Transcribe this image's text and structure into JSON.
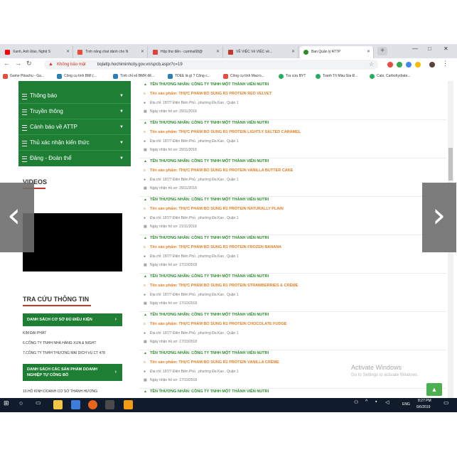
{
  "browser": {
    "tabs": [
      {
        "title": "Xanh, Anh Đào, Nghệ S",
        "color": "#ff0000"
      },
      {
        "title": "Tính năng chat dành cho N",
        "color": "#e74c3c"
      },
      {
        "title": "Hộp thư đến - cumhui68@",
        "color": "#db4437"
      },
      {
        "title": "VỀ VIỆC Về VIỆC về...",
        "color": "#c0392b"
      },
      {
        "title": "Ban Quản lý ATTP",
        "color": "#2e8b2e"
      }
    ],
    "new_tab": "+",
    "security_label": "Không bảo mật",
    "url": "bqlattp.hochiminhcity.gov.vn/spcb.aspx?c=19",
    "bookmarks": [
      {
        "label": "Game Pikachu - Ga...",
        "color": "#e74c3c"
      },
      {
        "label": "Công cụ tính BMI (...",
        "color": "#2980b9"
      },
      {
        "label": "Tính chỉ số BMR để...",
        "color": "#2980b9"
      },
      {
        "label": "TDEE là gì ? Công c...",
        "color": "#2980b9"
      },
      {
        "label": "Công cụ tính Macro...",
        "color": "#e74c3c"
      },
      {
        "label": "Tra cứu BYT",
        "color": "#27ae60"
      },
      {
        "label": "Tranh Tô Màu Gia Đ...",
        "color": "#27ae60"
      },
      {
        "label": "Calo, Carbohydrate...",
        "color": "#27ae60"
      }
    ]
  },
  "sidebar": {
    "menu": [
      {
        "label": "Thông báo"
      },
      {
        "label": "Truyền thông"
      },
      {
        "label": "Cảnh báo về ATTP"
      },
      {
        "label": "Thủ xác nhận kiến thức"
      },
      {
        "label": "Đảng - Đoàn thể"
      }
    ],
    "videos_heading": "VIDEOS",
    "lookup_heading": "TRA CỨU THÔNG TIN",
    "btn1": "DANH SÁCH CƠ SỞ ĐỦ ĐIỀU KIỆN",
    "list1": [
      "KIM ĐẠI PHÁT",
      "6.CÔNG TY TNHH NHÀ HÀNG XƯA & NIGHT",
      "7.CÔNG TY TNHH THƯƠNG MẠI DỊCH VỤ CT 478"
    ],
    "btn2_line1": "DANH SÁCH CÁC SẢN PHẨM DOANH",
    "btn2_line2": "NGHIỆP TỰ CÔNG BỐ",
    "list2": [
      "10.HỘ KINH DOANH CƠ SỞ THANH HƯƠNG"
    ]
  },
  "entries": [
    {
      "company": "TÊN THƯƠNG NHÂN: CÔNG TY TNHH MỘT THÀNH VIÊN NUTRI",
      "product": "Tên sản phẩm: THỰC PHẨM BỔ SUNG R1 PROTEIN RED VELVET",
      "address": "Địa chỉ: 187/7 Điện Biên Phủ , phường Đa Kao , Quận 1",
      "date": "Ngày nhận hồ sơ: 29/11/2018"
    },
    {
      "company": "TÊN THƯƠNG NHÂN: CÔNG TY TNHH MỘT THÀNH VIÊN NUTRI",
      "product": "Tên sản phẩm: THỰC PHẨM BỔ SUNG R1 PROTEIN LIGHTLY SALTED CARAMEL",
      "address": "Địa chỉ: 187/7 Điện Biên Phủ , phường Đa Kao , Quận 1",
      "date": "Ngày nhận hồ sơ: 29/11/2018"
    },
    {
      "company": "TÊN THƯƠNG NHÂN: CÔNG TY TNHH MỘT THÀNH VIÊN NUTRI",
      "product": "Tên sản phẩm: THỰC PHẨM BỔ SUNG R1 PROTEIN VANILLA BUTTER CAKE",
      "address": "Địa chỉ: 187/7 Điện Biên Phủ , phường Đa Kao , Quận 1",
      "date": "Ngày nhận hồ sơ: 29/11/2018"
    },
    {
      "company": "TÊN THƯƠNG NHÂN: CÔNG TY TNHH MỘT THÀNH VIÊN NUTRI",
      "product": "Tên sản phẩm: THỰC PHẨM BỔ SUNG R1 PROTEIN NATURALLY PLAIN",
      "address": "Địa chỉ: 187/7 Điện Biên Phủ , phường Đa Kao , Quận 1",
      "date": "Ngày nhận hồ sơ: 21/11/2018"
    },
    {
      "company": "TÊN THƯƠNG NHÂN: CÔNG TY TNHH MỘT THÀNH VIÊN NUTRI",
      "product": "Tên sản phẩm: THỰC PHẨM BỔ SUNG R1 PROTEIN FROZEN BANANA",
      "address": "Địa chỉ: 187/7 Điện Biên Phủ , phường Đa Kao , Quận 1",
      "date": "Ngày nhận hồ sơ: 17/10/2018"
    },
    {
      "company": "TÊN THƯƠNG NHÂN: CÔNG TY TNHH MỘT THÀNH VIÊN NUTRI",
      "product": "Tên sản phẩm: THỰC PHẨM BỔ SUNG R1 PROTEIN STRAWBERRIES & CRÈME",
      "address": "Địa chỉ: 187/7 Điện Biên Phủ , phường Đa Kao , Quận 1",
      "date": "Ngày nhận hồ sơ: 17/10/2018"
    },
    {
      "company": "TÊN THƯƠNG NHÂN: CÔNG TY TNHH MỘT THÀNH VIÊN NUTRI",
      "product": "Tên sản phẩm: THỰC PHẨM BỔ SUNG R1 PROTEIN CHOCOLATE FUDGE",
      "address": "Địa chỉ: 187/7 Điện Biên Phủ , phường Đa Kao , Quận 1",
      "date": "Ngày nhận hồ sơ: 17/10/2018"
    },
    {
      "company": "TÊN THƯƠNG NHÂN: CÔNG TY TNHH MỘT THÀNH VIÊN NUTRI",
      "product": "Tên sản phẩm: THỰC PHẨM BỔ SUNG R1 PROTEIN VANILLA CRÈME",
      "address": "Địa chỉ: 187/7 Điện Biên Phủ , phường Đa Kao , Quận 1",
      "date": "Ngày nhận hồ sơ: 17/10/2018"
    },
    {
      "company": "TÊN THƯƠNG NHÂN: CÔNG TY TNHH MỘT THÀNH VIÊN NUTRI",
      "product": "",
      "address": "",
      "date": ""
    }
  ],
  "watermark": {
    "line1": "Activate Windows",
    "line2": "Go to Settings to activate Windows."
  },
  "taskbar": {
    "lang": "ENG",
    "time": "8:27 PM",
    "date": "6/6/2019"
  },
  "overlay": {
    "prev": "‹",
    "next": "›"
  },
  "colors": {
    "green": "#1e7e34",
    "company_green": "#2e8b2e",
    "product_orange": "#e67e22",
    "warning_red": "#d93025"
  }
}
